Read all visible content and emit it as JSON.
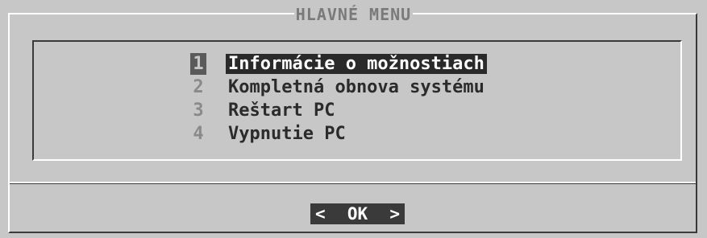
{
  "dialog": {
    "title": "HLAVNÉ MENU"
  },
  "menu": {
    "items": [
      {
        "number": "1",
        "label": "Informácie o možnostiach",
        "selected": true
      },
      {
        "number": "2",
        "label": "Kompletná obnova systému",
        "selected": false
      },
      {
        "number": "3",
        "label": "Reštart PC",
        "selected": false
      },
      {
        "number": "4",
        "label": "Vypnutie PC",
        "selected": false
      }
    ]
  },
  "footer": {
    "ok_left": "<",
    "ok_label": "OK",
    "ok_right": ">"
  }
}
